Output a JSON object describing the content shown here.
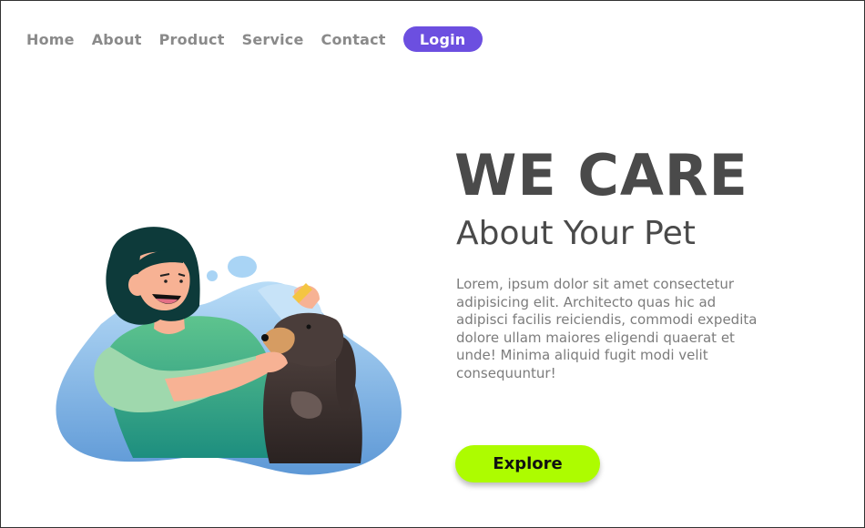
{
  "nav": {
    "items": [
      {
        "label": "Home"
      },
      {
        "label": "About"
      },
      {
        "label": "Product"
      },
      {
        "label": "Service"
      },
      {
        "label": "Contact"
      }
    ],
    "login_label": "Login"
  },
  "hero": {
    "headline": "WE CARE",
    "subheadline": "About Your Pet",
    "paragraph": "Lorem, ipsum dolor sit amet consectetur adipisicing elit. Architecto quas hic ad adipisci facilis reiciendis, commodi expedita dolore ullam maiores eligendi quaerat et unde! Minima aliquid fugit modi velit consequuntur!",
    "cta_label": "Explore"
  },
  "colors": {
    "accent": "#6c4fe0",
    "cta": "#adfc00",
    "heading": "#4a4a4a",
    "nav_text": "#8a8a8a"
  },
  "illustration": {
    "icon": "woman-caring-for-dog-illustration"
  }
}
